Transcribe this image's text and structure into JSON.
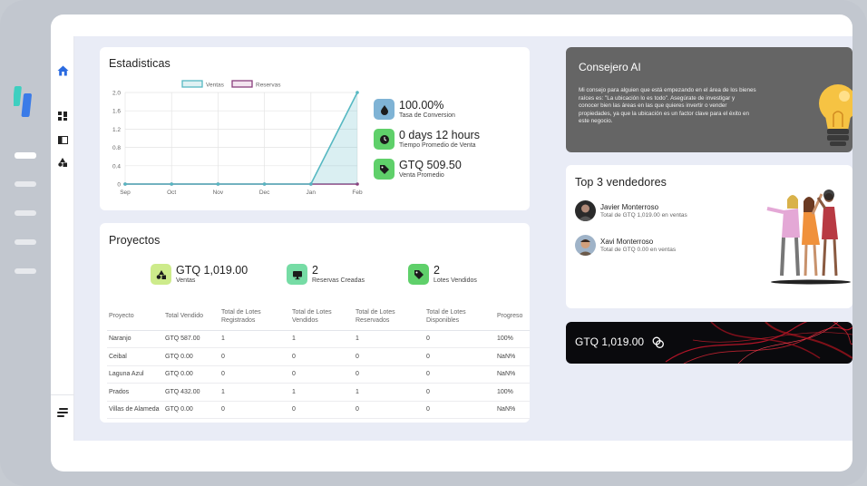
{
  "stats": {
    "title": "Estadisticas",
    "kpis": [
      {
        "value": "100.00%",
        "label": "Tasa de Conversion",
        "icon": "drop-icon",
        "color": "#7fb3d5"
      },
      {
        "value": "0 days 12 hours",
        "label": "Tiempo Promedio de Venta",
        "icon": "clock-icon",
        "color": "#5fd06a"
      },
      {
        "value": "GTQ 509.50",
        "label": "Venta Promedio",
        "icon": "tag-icon",
        "color": "#5fd06a"
      }
    ]
  },
  "chart_data": {
    "type": "area",
    "categories": [
      "Sep",
      "Oct",
      "Nov",
      "Dec",
      "Jan",
      "Feb"
    ],
    "series": [
      {
        "name": "Ventas",
        "values": [
          0,
          0,
          0,
          0,
          0,
          2
        ],
        "color": "#56b8c2"
      },
      {
        "name": "Reservas",
        "values": [
          0,
          0,
          0,
          0,
          0,
          0
        ],
        "color": "#8a3f7d"
      }
    ],
    "y_ticks": [
      "0",
      "0.4",
      "0.8",
      "1.2",
      "1.6",
      "2.0"
    ],
    "ylim": [
      0,
      2
    ],
    "legend": "top-center",
    "grid": true
  },
  "projects": {
    "title": "Proyectos",
    "kpis": [
      {
        "value": "GTQ 1,019.00",
        "label": "Ventas",
        "icon": "triangle-icon",
        "color": "#cdeb8b"
      },
      {
        "value": "2",
        "label": "Reservas Creadas",
        "icon": "monitor-icon",
        "color": "#76dca5"
      },
      {
        "value": "2",
        "label": "Lotes Vendidos",
        "icon": "tag-icon",
        "color": "#5fd06a"
      }
    ],
    "columns": [
      "Proyecto",
      "Total Vendido",
      "Total de Lotes Registrados",
      "Total de Lotes Vendidos",
      "Total de Lotes Reservados",
      "Total de Lotes Disponibles",
      "Progreso"
    ],
    "rows": [
      [
        "Naranjo",
        "GTQ 587.00",
        "1",
        "1",
        "1",
        "0",
        "100%"
      ],
      [
        "Ceibal",
        "GTQ 0.00",
        "0",
        "0",
        "0",
        "0",
        "NaN%"
      ],
      [
        "Laguna Azul",
        "GTQ 0.00",
        "0",
        "0",
        "0",
        "0",
        "NaN%"
      ],
      [
        "Prados",
        "GTQ 432.00",
        "1",
        "1",
        "1",
        "0",
        "100%"
      ],
      [
        "Villas de Alameda",
        "GTQ 0.00",
        "0",
        "0",
        "0",
        "0",
        "NaN%"
      ]
    ]
  },
  "ai": {
    "title": "Consejero AI",
    "text": "Mi consejo para alguien que está empezando en el área de los bienes raíces es: \"La ubicación lo es todo\". Asegúrate de investigar y conocer bien las áreas en las que quieres invertir o vender propiedades, ya que la ubicación es un factor clave para el éxito en este negocio."
  },
  "top": {
    "title": "Top 3 vendedores",
    "sellers": [
      {
        "name": "Javier Monterroso",
        "total": "Total de GTQ 1,019.00 en ventas"
      },
      {
        "name": "Xavi Monterroso",
        "total": "Total de GTQ 0.00 en ventas"
      }
    ]
  },
  "balance": {
    "value": "GTQ 1,019.00",
    "icon": "coins-icon"
  }
}
